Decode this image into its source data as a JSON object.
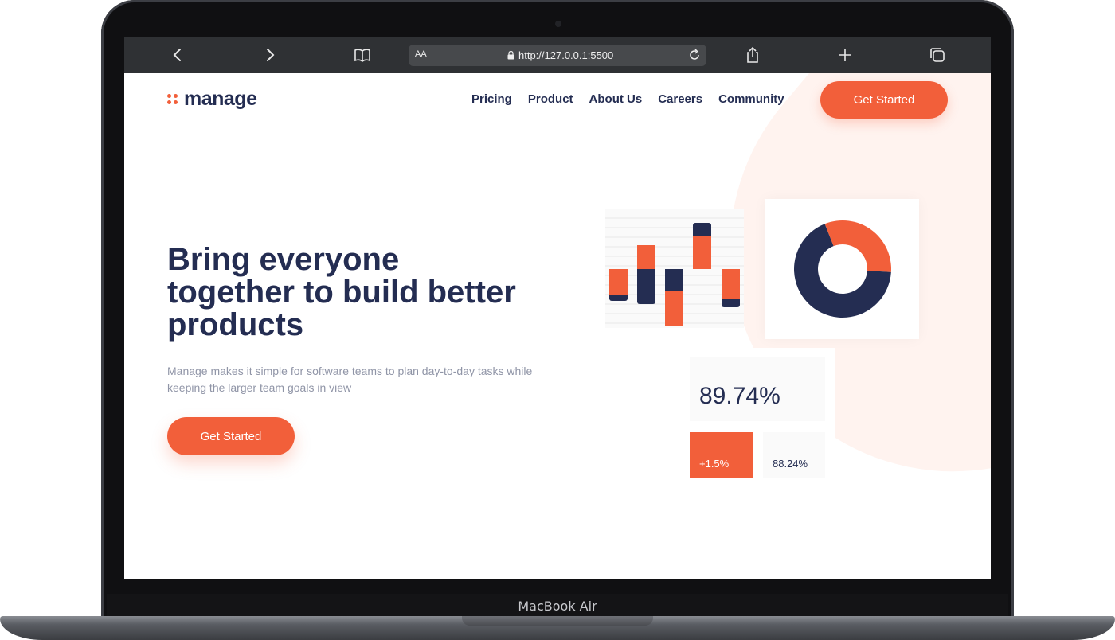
{
  "device": {
    "label": "MacBook Air"
  },
  "browser": {
    "text_size_label": "AA",
    "url": "http://127.0.0.1:5500",
    "icons": [
      "back-icon",
      "forward-icon",
      "bookmarks-icon",
      "lock-icon",
      "reload-icon",
      "share-icon",
      "new-tab-icon",
      "tabs-icon"
    ]
  },
  "header": {
    "logo_text": "manage",
    "nav": [
      "Pricing",
      "Product",
      "About Us",
      "Careers",
      "Community"
    ],
    "cta_label": "Get Started"
  },
  "hero": {
    "title": "Bring everyone together to build better products",
    "subtitle": "Manage makes it simple for software teams to plan day-to-day tasks while keeping the larger team goals in view",
    "cta_label": "Get Started"
  },
  "colors": {
    "accent": "#f25f3a",
    "navy": "#242d52",
    "muted": "#9095a7",
    "shape": "#fff3ef"
  },
  "dashboard": {
    "stat_main": "89.74%",
    "stat_change": "+1.5%",
    "stat_secondary": "88.24%",
    "donut": {
      "orange_fraction": 0.32,
      "navy_fraction": 0.68
    }
  }
}
